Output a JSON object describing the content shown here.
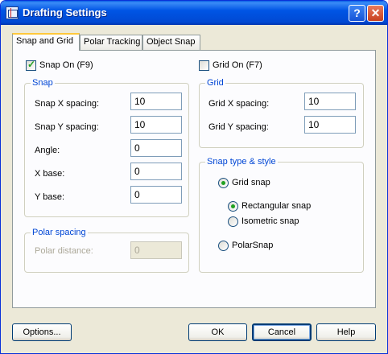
{
  "window": {
    "title": "Drafting Settings",
    "help_button": "?",
    "close_button": "✕"
  },
  "tabs": [
    {
      "label": "Snap and Grid"
    },
    {
      "label": "Polar Tracking"
    },
    {
      "label": "Object Snap"
    }
  ],
  "snap_on": {
    "label": "Snap On (F9)",
    "checked": true
  },
  "grid_on": {
    "label": "Grid On (F7)",
    "checked": false
  },
  "snap_group": {
    "title": "Snap",
    "x_spacing": {
      "label": "Snap X spacing:",
      "value": "10"
    },
    "y_spacing": {
      "label": "Snap Y spacing:",
      "value": "10"
    },
    "angle": {
      "label": "Angle:",
      "value": "0"
    },
    "x_base": {
      "label": "X base:",
      "value": "0"
    },
    "y_base": {
      "label": "Y base:",
      "value": "0"
    }
  },
  "polar_group": {
    "title": "Polar spacing",
    "distance": {
      "label": "Polar distance:",
      "value": "0"
    }
  },
  "grid_group": {
    "title": "Grid",
    "x_spacing": {
      "label": "Grid X spacing:",
      "value": "10"
    },
    "y_spacing": {
      "label": "Grid Y spacing:",
      "value": "10"
    }
  },
  "snap_type_group": {
    "title": "Snap type & style",
    "grid_snap": "Grid snap",
    "rectangular_snap": "Rectangular snap",
    "isometric_snap": "Isometric snap",
    "polar_snap": "PolarSnap",
    "selected": "Grid snap",
    "selected_style": "Rectangular snap"
  },
  "buttons": {
    "options": "Options...",
    "ok": "OK",
    "cancel": "Cancel",
    "help": "Help"
  }
}
